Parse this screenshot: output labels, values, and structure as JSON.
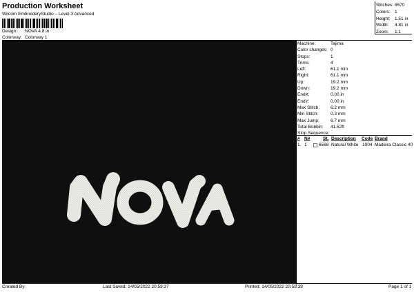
{
  "header": {
    "title": "Production Worksheet",
    "subtitle": "Wilcom EmbroideryStudio – Level 3 Advanced"
  },
  "design_info": [
    {
      "label": "Design:",
      "value": "NOVA 4.8 in"
    },
    {
      "label": "Colorway:",
      "value": "Colorway 1"
    }
  ],
  "stats": [
    {
      "label": "Stitches:",
      "value": "6570"
    },
    {
      "label": "Colors:",
      "value": "1"
    },
    {
      "label": "Height:",
      "value": "1.51 in"
    },
    {
      "label": "Width:",
      "value": "4.81 in"
    },
    {
      "label": "Zoom:",
      "value": "1:1"
    }
  ],
  "preview": {
    "design_text": "NOVA",
    "background_color": "#0f0f0f",
    "thread_color": "#f0f1ec"
  },
  "machine_details": [
    {
      "label": "Machine:",
      "value": "Tajima"
    },
    {
      "label": "Color changes:",
      "value": "0"
    },
    {
      "label": "Stops:",
      "value": "1"
    },
    {
      "label": "Trims:",
      "value": "4"
    },
    {
      "label": "Left:",
      "value": "61.1 mm"
    },
    {
      "label": "Right:",
      "value": "61.1 mm"
    },
    {
      "label": "Up:",
      "value": "19.2 mm"
    },
    {
      "label": "Down:",
      "value": "19.2 mm"
    },
    {
      "label": "EndX:",
      "value": "0.00 in"
    },
    {
      "label": "EndY:",
      "value": "0.00 in"
    },
    {
      "label": "Max Stitch:",
      "value": "6.2 mm"
    },
    {
      "label": "Min Stitch:",
      "value": "0.3 mm"
    },
    {
      "label": "Max Jump:",
      "value": "6.7 mm"
    },
    {
      "label": "Total Bobbin:",
      "value": "41.52ft"
    }
  ],
  "stop_sequence": {
    "title": "Stop Sequence:",
    "columns": [
      "#",
      "N#",
      "St.",
      "Description",
      "Code",
      "Brand"
    ],
    "rows": [
      {
        "num": "1.",
        "n": "1",
        "stitches": "6568",
        "description": "Natural White",
        "code": "1004",
        "brand": "Madeira Classic 40"
      }
    ]
  },
  "footer": {
    "created_by": "Created By:",
    "last_saved": "Last Saved: 14/05/2022 20:59:37",
    "printed": "Printed: 14/05/2022 20:59:39",
    "page": "Page 1 of 1"
  }
}
